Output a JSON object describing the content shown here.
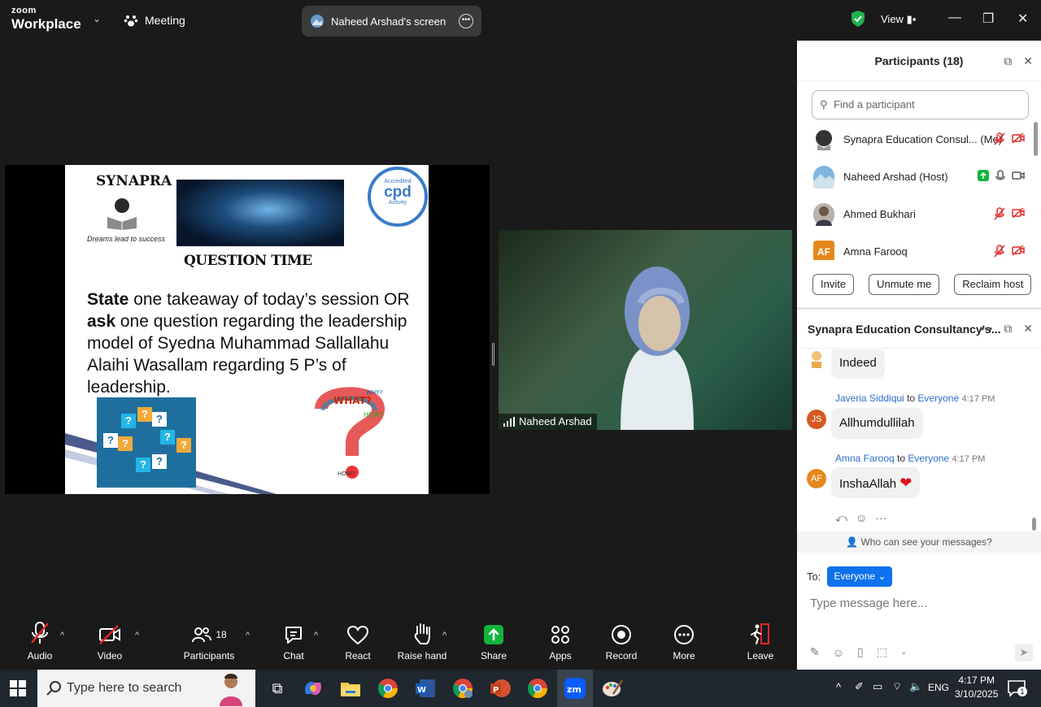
{
  "topbar": {
    "brand_small": "zoom",
    "brand_big": "Workplace",
    "meeting_label": "Meeting",
    "share_pill": "Naheed Arshad's screen",
    "view_label": "View"
  },
  "slide": {
    "logo_title": "SYNAPRA",
    "logo_tagline": "Dreams lead to success",
    "cpd_top": "Accredited",
    "cpd_main": "cpd",
    "cpd_bottom": "Activity",
    "heading": "QUESTION TIME",
    "line_bold_1": "State",
    "line_1": " one takeaway of today’s session OR ",
    "line_bold_2": "ask",
    "line_2": " one question regarding the leadership model of Syedna Muhammad Sallallahu Alaihi Wasallam regarding 5 P’s of leadership."
  },
  "video": {
    "name": "Naheed Arshad"
  },
  "toolbar": {
    "audio": "Audio",
    "video": "Video",
    "participants": "Participants",
    "participants_count": "18",
    "chat": "Chat",
    "react": "React",
    "raise_hand": "Raise hand",
    "share": "Share",
    "apps": "Apps",
    "record": "Record",
    "more": "More",
    "leave": "Leave"
  },
  "participants": {
    "title": "Participants (18)",
    "search_placeholder": "Find a participant",
    "list": [
      {
        "name": "Synapra Education Consul... (Me)"
      },
      {
        "name": "Naheed Arshad (Host)"
      },
      {
        "name": "Ahmed Bukhari"
      },
      {
        "name": "Amna Farooq",
        "initials": "AF"
      }
    ],
    "buttons": {
      "invite": "Invite",
      "unmute": "Unmute me",
      "reclaim": "Reclaim host"
    }
  },
  "chat": {
    "title": "Synapra Education Consultancy's...",
    "messages": [
      {
        "text": "Indeed"
      },
      {
        "sender": "Javeria Siddiqui",
        "to_word": "to",
        "recipient": "Everyone",
        "time": "4:17 PM",
        "initials": "JS",
        "text": "Allhumdullilah"
      },
      {
        "sender": "Amna Farooq",
        "to_word": "to",
        "recipient": "Everyone",
        "time": "4:17 PM",
        "initials": "AF",
        "text": "InshaAllah"
      }
    ],
    "who_can_see": "Who can see your messages?",
    "to_label": "To:",
    "to_value": "Everyone",
    "input_placeholder": "Type message here..."
  },
  "taskbar": {
    "search_placeholder": "Type here to search",
    "lang": "ENG",
    "time": "4:17 PM",
    "date": "3/10/2025",
    "notif_count": "1"
  },
  "colors": {
    "accent": "#0e72ed",
    "share_green": "#12b53c",
    "mute_red": "#e02828",
    "avatar_orange": "#e5881c",
    "avatar_red": "#d45a22"
  }
}
